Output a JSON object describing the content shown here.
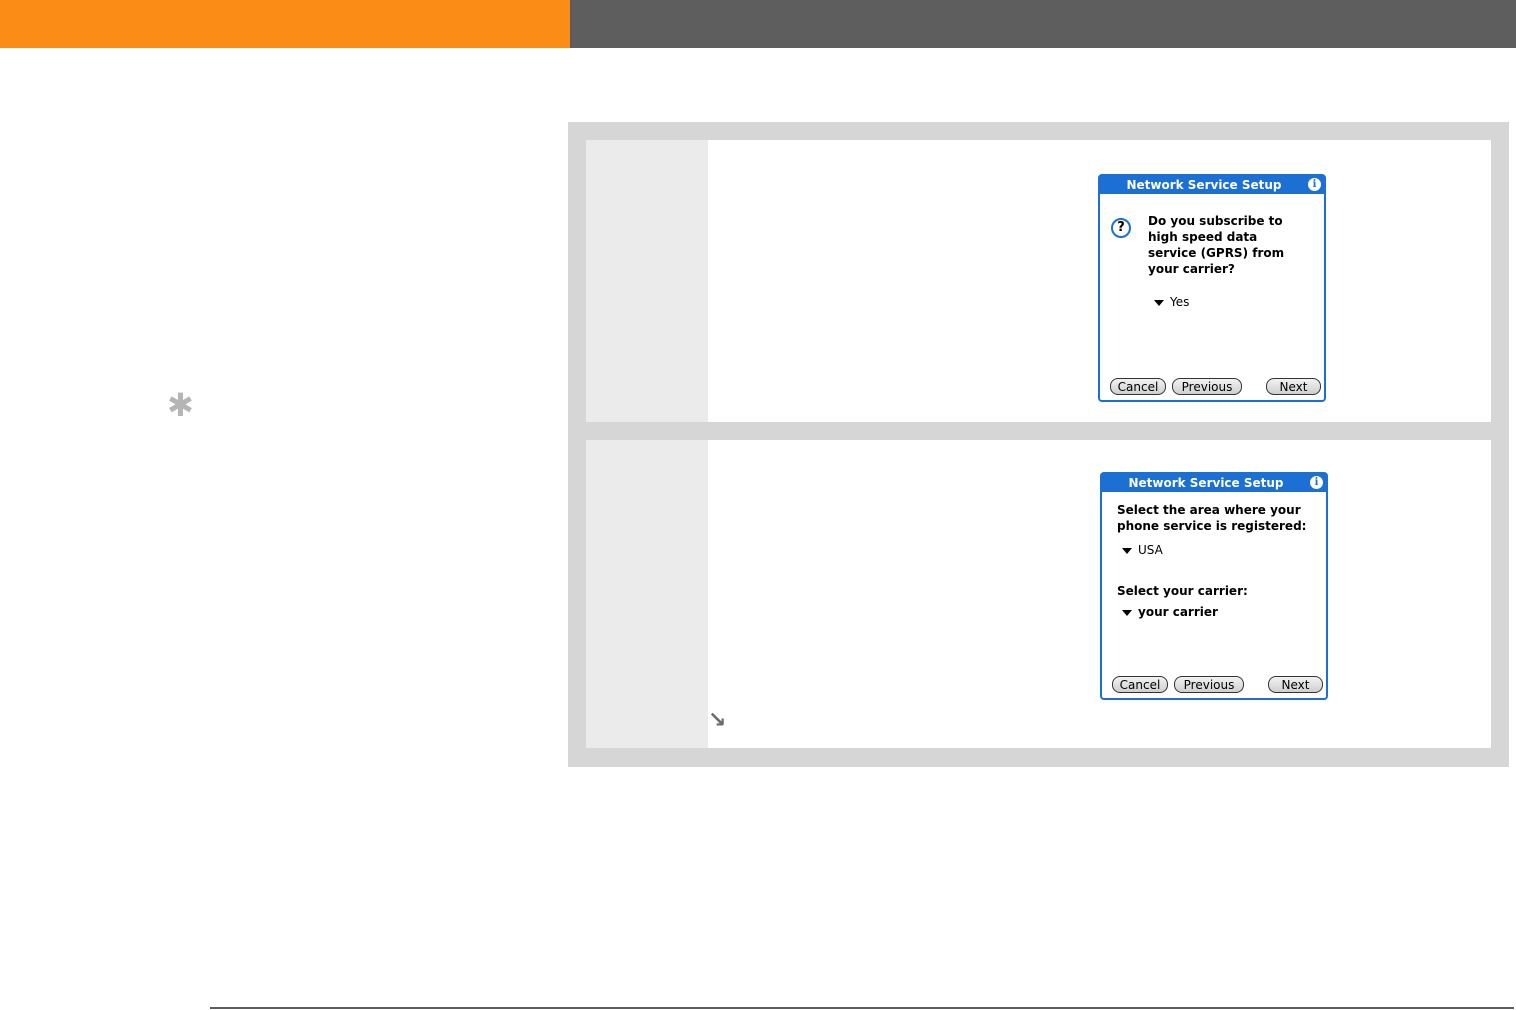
{
  "tip_icon": "asterisk-icon",
  "step1_dialog": {
    "title": "Network Service Setup",
    "info_icon_glyph": "i",
    "question_icon_glyph": "?",
    "question_lines": [
      "Do you subscribe to",
      "high speed data",
      "service (GPRS) from",
      "your carrier?"
    ],
    "dropdown_value": "Yes",
    "buttons": {
      "cancel": "Cancel",
      "previous": "Previous",
      "next": "Next"
    }
  },
  "step2_dialog": {
    "title": "Network Service Setup",
    "info_icon_glyph": "i",
    "area_prompt_lines": [
      "Select the area where your",
      "phone service is registered:"
    ],
    "area_value": "USA",
    "carrier_prompt": "Select your carrier:",
    "carrier_value": "your carrier",
    "buttons": {
      "cancel": "Cancel",
      "previous": "Previous",
      "next": "Next"
    }
  },
  "continue_icon": "arrow-down-right-icon",
  "colors": {
    "orange": "#fb8c15",
    "gray_bar": "#5e5e5e",
    "palm_blue": "#1c6fd3"
  }
}
